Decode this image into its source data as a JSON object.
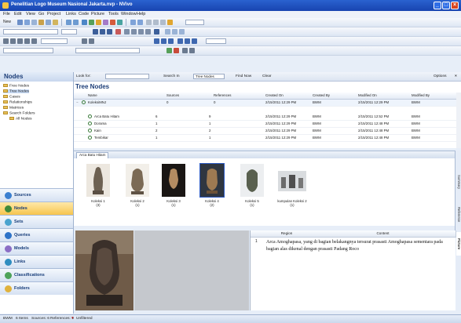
{
  "window": {
    "title": "Penelitian Logo Museum Nasional Jakarta.nvp - NVivo"
  },
  "menu": [
    "File",
    "Edit",
    "View",
    "Go",
    "Project",
    "Links",
    "Code",
    "Picture",
    "Tools",
    "Window",
    "Help"
  ],
  "toolbar": {
    "new_label": "New"
  },
  "left": {
    "title": "Nodes",
    "tree": [
      "Free Nodes",
      "Tree Nodes",
      "Cases",
      "Relationships",
      "Matrices",
      "Search Folders",
      "All Nodes"
    ],
    "nav": [
      "Sources",
      "Nodes",
      "Sets",
      "Queries",
      "Models",
      "Links",
      "Classifications",
      "Folders"
    ]
  },
  "find": {
    "look_for": "Look for:",
    "search_in": "Search In",
    "scope": "Tree Nodes",
    "find_now": "Find Now",
    "clear": "Clear",
    "options": "Options"
  },
  "list": {
    "title": "Tree Nodes",
    "columns": [
      "Name",
      "Sources",
      "References",
      "Created On",
      "Created By",
      "Modified On",
      "Modified By"
    ],
    "rows": [
      {
        "name": "KoleksiMNJ",
        "sources": "0",
        "refs": "0",
        "created": "2/15/2011 12:29 PM",
        "by": "BWM",
        "modified": "2/15/2011 12:29 PM",
        "mby": "BWM"
      },
      {
        "name": "Arca Batu Hitam",
        "sources": "6",
        "refs": "9",
        "created": "2/15/2011 12:29 PM",
        "by": "BWM",
        "modified": "2/15/2011 12:52 PM",
        "mby": "BWM"
      },
      {
        "name": "Dorama",
        "sources": "1",
        "refs": "1",
        "created": "2/15/2011 12:29 PM",
        "by": "BWM",
        "modified": "2/15/2011 12:48 PM",
        "mby": "BWM"
      },
      {
        "name": "Kain",
        "sources": "2",
        "refs": "2",
        "created": "2/15/2011 12:29 PM",
        "by": "BWM",
        "modified": "2/15/2011 12:48 PM",
        "mby": "BWM"
      },
      {
        "name": "Tembikar",
        "sources": "1",
        "refs": "1",
        "created": "2/15/2011 12:29 PM",
        "by": "BWM",
        "modified": "2/15/2011 12:48 PM",
        "mby": "BWM"
      }
    ]
  },
  "detail": {
    "tab": "Arca Batu Hitam",
    "thumbs": [
      {
        "cap1": "Koleksi 1",
        "cap2": "(3)"
      },
      {
        "cap1": "Koleksi 2",
        "cap2": "(1)"
      },
      {
        "cap1": "Koleksi 3",
        "cap2": "(1)"
      },
      {
        "cap1": "Koleksi 4",
        "cap2": "(2)"
      },
      {
        "cap1": "Koleksi 5",
        "cap2": "(1)"
      },
      {
        "cap1": "kumpulan Koleksi 2",
        "cap2": "(1)"
      }
    ],
    "vtabs": [
      "Summary",
      "Reference",
      "Picture"
    ]
  },
  "grid": {
    "col_region": "Region",
    "col_content": "Content",
    "row_num": "1",
    "content": "Arca Amoghapasa, yang di bagian belakangnya tersurat prasasti Amoghapasa sementara pada bagian alas dikenal dengan prasasti Padang Roco"
  },
  "status": {
    "user": "BWM",
    "items": "6 Items",
    "sources": "Sources: 6",
    "refs": "References: 9",
    "state": "Unfiltered"
  }
}
